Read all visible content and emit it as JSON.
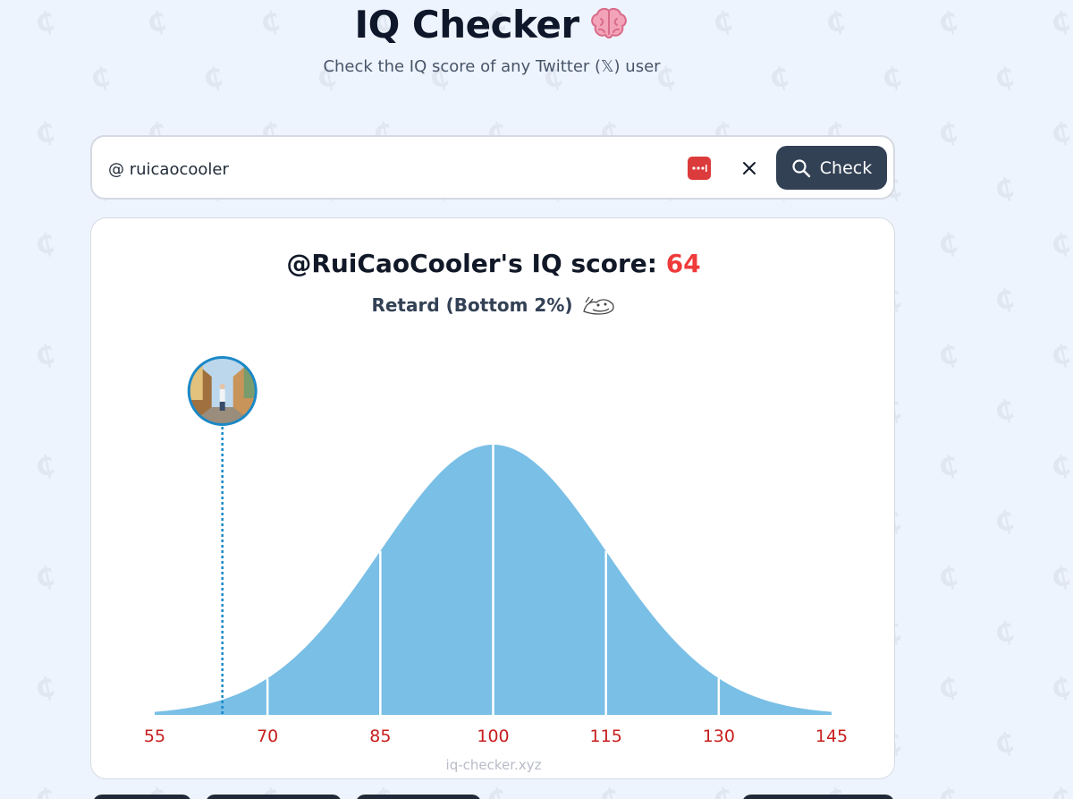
{
  "app": {
    "title": "IQ Checker",
    "subtitle": "Check the IQ score of any Twitter (𝕏) user",
    "brain_icon": "brain-emoji-icon"
  },
  "search": {
    "value": "@ ruicaocooler",
    "password_manager_icon": "password-manager-icon",
    "clear_icon": "close-icon",
    "check_label": "Check",
    "check_icon": "search-icon"
  },
  "result": {
    "handle_text": "@RuiCaoCooler's IQ score:",
    "score": "64",
    "category": "Retard (Bottom 2%)",
    "category_icon": "retard-face-icon",
    "watermark": "iq-checker.xyz"
  },
  "colors": {
    "accent_red": "#ef3b3b",
    "curve_fill": "#79bfe6",
    "marker_blue": "#1b88c7",
    "button_dark": "#334155"
  },
  "chart_data": {
    "type": "area",
    "title": "",
    "xlabel": "",
    "ylabel": "",
    "distribution": "normal",
    "mean": 100,
    "sd": 15,
    "xlim": [
      55,
      145
    ],
    "x_ticks": [
      55,
      70,
      85,
      100,
      115,
      130,
      145
    ],
    "tick_labels": [
      "55",
      "70",
      "85",
      "100",
      "115",
      "130",
      "145"
    ],
    "dividers": [
      70,
      85,
      100,
      115,
      130
    ],
    "marker": {
      "value": 64,
      "avatar": "user-avatar"
    }
  }
}
